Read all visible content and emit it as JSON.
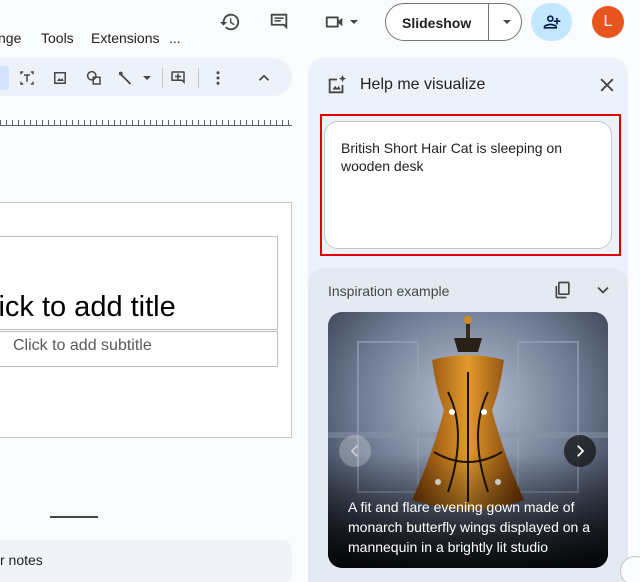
{
  "menu": {
    "items": [
      "nge",
      "Tools",
      "Extensions",
      "..."
    ]
  },
  "header": {
    "history_icon": "history-icon",
    "comments_icon": "comment-icon",
    "meet_icon": "videocam-icon",
    "slideshow_label": "Slideshow",
    "share_icon": "person-add-icon",
    "avatar_letter": "L",
    "avatar_color": "#e8541d",
    "share_color": "#c2e7ff"
  },
  "toolbar": {
    "icons": [
      "text-box-icon",
      "image-icon",
      "shapes-icon",
      "line-icon",
      "line-dropdown-icon",
      "comment-add-icon",
      "more-icon",
      "collapse-icon"
    ]
  },
  "slide": {
    "title_placeholder": "lick to add title",
    "subtitle_placeholder": "Click to add subtitle",
    "notes_placeholder": "r notes"
  },
  "panel": {
    "title": "Help me visualize",
    "prompt_text": "British Short Hair Cat is sleeping on wooden desk",
    "highlight_color": "#e00000",
    "inspiration": {
      "label": "Inspiration example",
      "caption": "A fit and flare evening gown made of monarch butterfly wings displayed on a mannequin in a brightly lit studio"
    }
  }
}
